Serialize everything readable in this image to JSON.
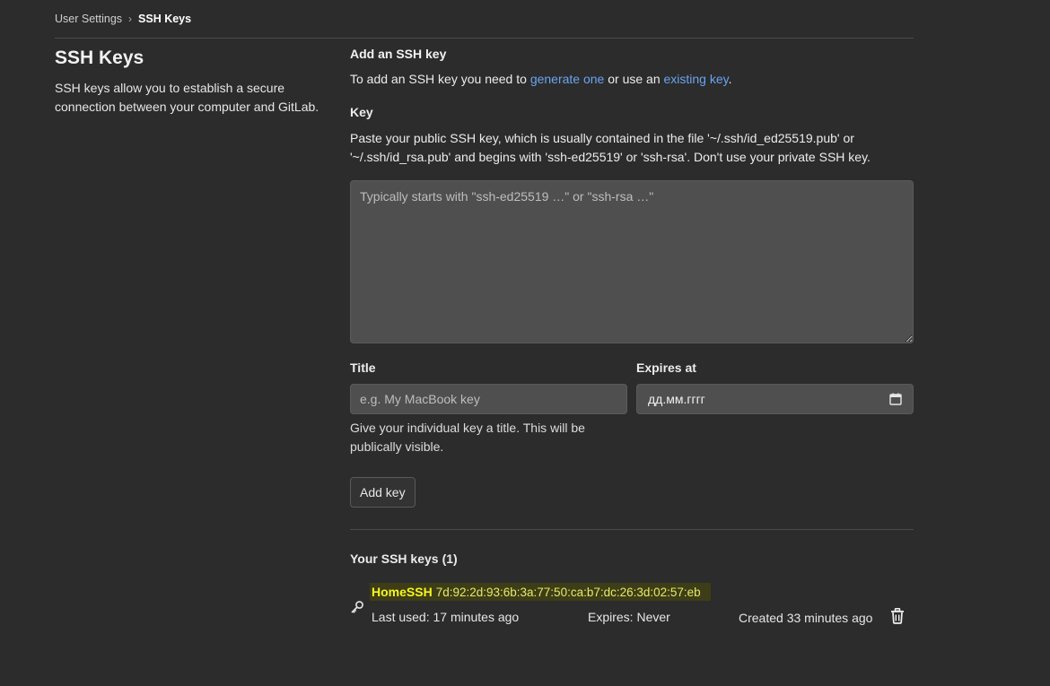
{
  "breadcrumb": {
    "parent": "User Settings",
    "current": "SSH Keys"
  },
  "left": {
    "title": "SSH Keys",
    "description": "SSH keys allow you to establish a secure connection between your computer and GitLab."
  },
  "form": {
    "heading": "Add an SSH key",
    "intro_prefix": "To add an SSH key you need to ",
    "link_generate": "generate one",
    "intro_middle": " or use an ",
    "link_existing": "existing key",
    "intro_suffix": ".",
    "key_label": "Key",
    "key_help": "Paste your public SSH key, which is usually contained in the file '~/.ssh/id_ed25519.pub' or '~/.ssh/id_rsa.pub' and begins with 'ssh-ed25519' or 'ssh-rsa'. Don't use your private SSH key.",
    "key_placeholder": "Typically starts with \"ssh-ed25519 …\" or \"ssh-rsa …\"",
    "key_value": "",
    "title_label": "Title",
    "title_placeholder": "e.g. My MacBook key",
    "title_value": "",
    "title_help": "Give your individual key a title. This will be publically visible.",
    "expires_label": "Expires at",
    "expires_placeholder": "дд.мм.гггг",
    "add_button": "Add key"
  },
  "keys_list": {
    "heading": "Your SSH keys",
    "count": "(1)",
    "items": [
      {
        "name": "HomeSSH",
        "fingerprint": "7d:92:2d:93:6b:3a:77:50:ca:b7:dc:26:3d:02:57:eb",
        "last_used": "Last used: 17 minutes ago",
        "expires": "Expires: Never",
        "created": "Created 33 minutes ago",
        "icon": "key-icon",
        "highlight_color": "#3d3d17",
        "name_color": "#f5f51e"
      }
    ]
  },
  "colors": {
    "background": "#2c2c2c",
    "input_bg": "#4f4f4f",
    "link": "#6aa4ef"
  }
}
